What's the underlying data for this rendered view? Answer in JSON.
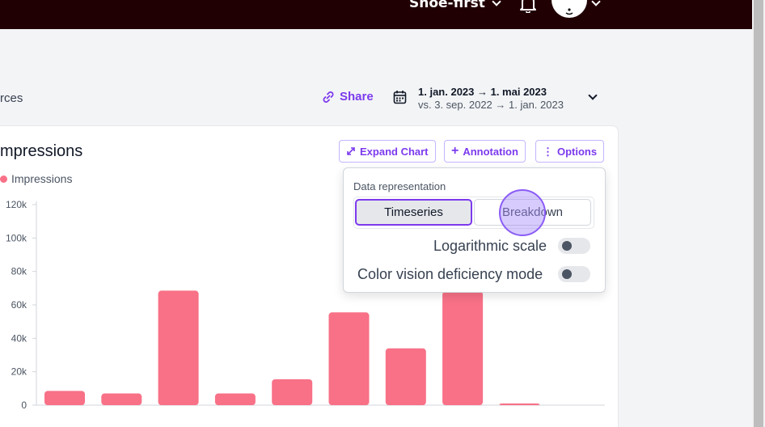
{
  "topbar": {
    "shop_name": "Shoe-first",
    "icons": [
      "chevron-down-icon",
      "bell-icon",
      "avatar",
      "chevron-down-icon"
    ]
  },
  "toolbar": {
    "sources_label": "rces",
    "share_label": "Share",
    "date_range": {
      "main": "1. jan. 2023 → 1. mai 2023",
      "compare": "vs. 3. sep. 2022 → 1. jan. 2023"
    }
  },
  "card": {
    "title": "mpressions",
    "legend_label": "Impressions",
    "buttons": {
      "expand": "Expand Chart",
      "annotation": "Annotation",
      "options": "Options"
    }
  },
  "popover": {
    "section_label": "Data representation",
    "timeseries_label": "Timeseries",
    "breakdown_label": "Breakdown",
    "log_scale_label": "Logarithmic scale",
    "color_vision_label": "Color vision deficiency mode"
  },
  "colors": {
    "accent": "#7c3aed",
    "bar": "#f87187",
    "topbar": "#210004"
  },
  "chart_data": {
    "type": "bar",
    "ylim": [
      0,
      120000
    ],
    "yticks": [
      "0",
      "20k",
      "40k",
      "60k",
      "80k",
      "100k",
      "120k"
    ],
    "ytick_values": [
      0,
      20000,
      40000,
      60000,
      80000,
      100000,
      120000
    ],
    "series": [
      {
        "name": "Impressions",
        "values": [
          8500,
          7000,
          68500,
          7000,
          15500,
          55500,
          34000,
          68000,
          1000
        ]
      }
    ]
  }
}
